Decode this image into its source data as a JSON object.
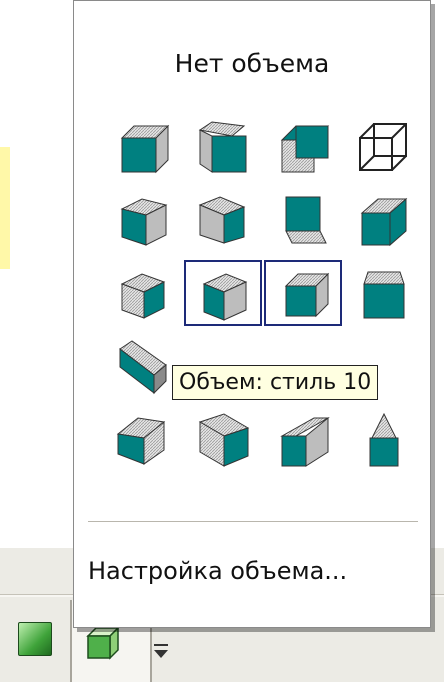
{
  "colors": {
    "accent": "#008080",
    "selection_border": "#1d2a78",
    "tooltip_bg": "#ffffe1"
  },
  "menu": {
    "title": "Нет объема",
    "settings_label": "Настройка объема...",
    "styles": [
      {
        "name": "style-1",
        "icon": "cube-front-icon"
      },
      {
        "name": "style-2",
        "icon": "cube-side-icon"
      },
      {
        "name": "style-3",
        "icon": "cube-down-left-icon"
      },
      {
        "name": "style-4",
        "icon": "wireframe-cube-icon"
      },
      {
        "name": "style-5",
        "icon": "cube-tilt-left-icon"
      },
      {
        "name": "style-6",
        "icon": "cube-tilt-right-icon"
      },
      {
        "name": "style-7",
        "icon": "cube-bottom-icon"
      },
      {
        "name": "style-8",
        "icon": "cube-lean-icon"
      },
      {
        "name": "style-9",
        "icon": "cube-rotated-left-icon"
      },
      {
        "name": "style-10",
        "icon": "cube-rotated-right-icon",
        "selected": true
      },
      {
        "name": "style-11",
        "icon": "cube-up-right-icon",
        "selected": true
      },
      {
        "name": "style-12",
        "icon": "cube-top-icon"
      },
      {
        "name": "style-13",
        "icon": "cube-oblique-icon"
      },
      {
        "name": "style-14",
        "icon": "cube-hidden-icon"
      },
      {
        "name": "style-15",
        "icon": "cube-hidden-icon"
      },
      {
        "name": "style-16",
        "icon": "cube-hidden-icon"
      },
      {
        "name": "style-17",
        "icon": "cube-left-perspective-icon"
      },
      {
        "name": "style-18",
        "icon": "cube-right-perspective-icon"
      },
      {
        "name": "style-19",
        "icon": "wedge-icon"
      },
      {
        "name": "style-20",
        "icon": "pyramid-top-icon"
      }
    ]
  },
  "tooltip": {
    "text": "Объем: стиль 10"
  },
  "toolbar": {
    "shadow_button_icon": "green-square-icon",
    "three_d_button_icon": "green-cube-icon",
    "dropdown_icon": "chevron-down-icon"
  }
}
